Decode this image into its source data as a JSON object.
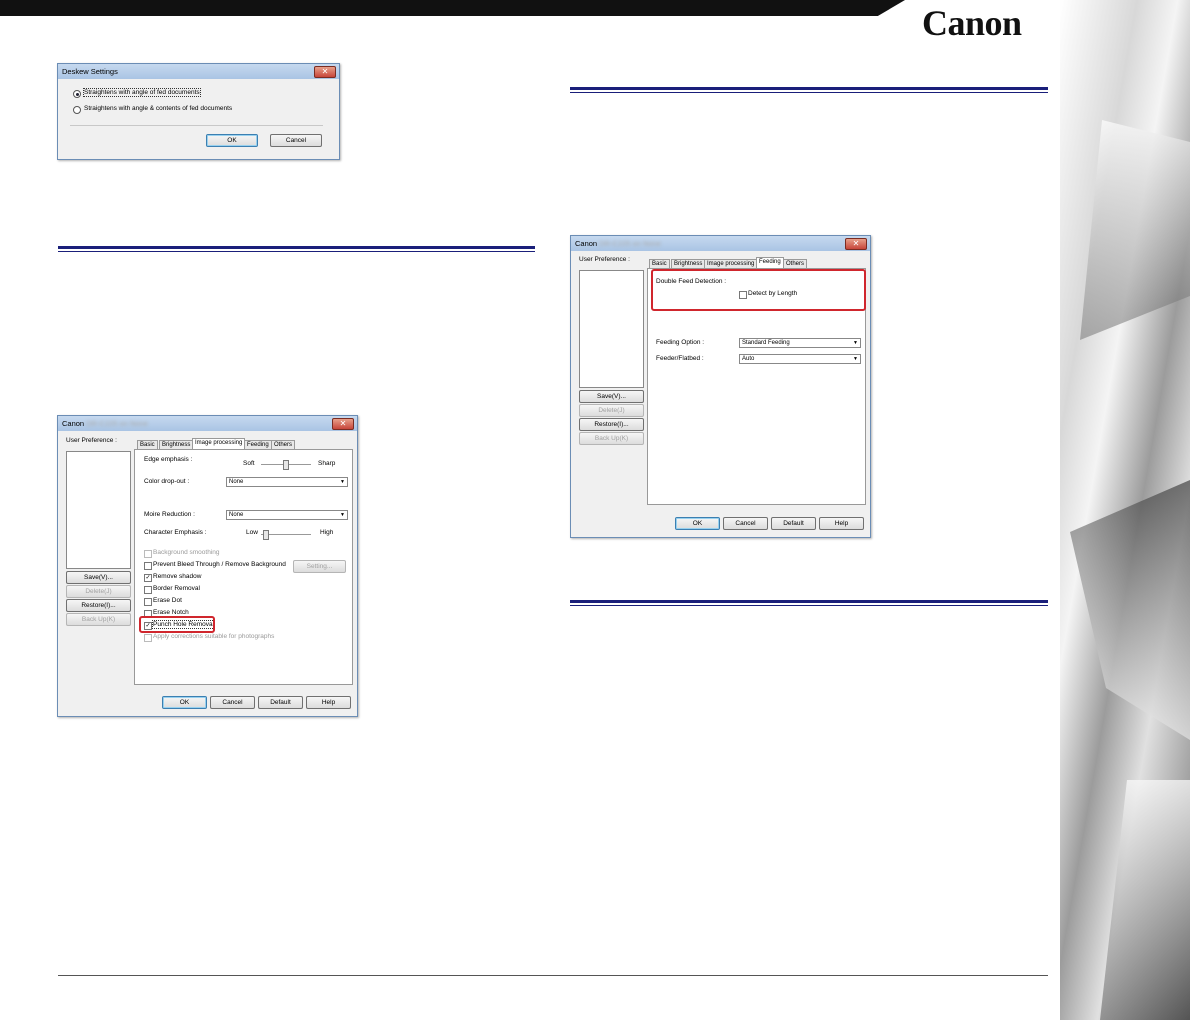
{
  "brand": {
    "logo": "Canon"
  },
  "deskew_dialog": {
    "title": "Deskew Settings",
    "options": [
      {
        "label": "Straightens with angle of fed documents",
        "selected": true
      },
      {
        "label": "Straightens with angle & contents of fed documents",
        "selected": false
      }
    ],
    "ok_label": "OK",
    "cancel_label": "Cancel"
  },
  "image_dialog": {
    "title": "Canon",
    "user_pref_label": "User Preference :",
    "buttons_left": {
      "save": "Save(V)...",
      "delete": "Delete(J)",
      "restore": "Restore(I)...",
      "backup": "Back Up(K)"
    },
    "tabs": [
      "Basic",
      "Brightness",
      "Image processing",
      "Feeding",
      "Others"
    ],
    "active_tab": "Image processing",
    "edge_emphasis": {
      "label": "Edge emphasis :",
      "min": "Soft",
      "max": "Sharp"
    },
    "color_dropout": {
      "label": "Color drop-out :",
      "value": "None"
    },
    "moire": {
      "label": "Moire Reduction :",
      "value": "None"
    },
    "char_emphasis": {
      "label": "Character Emphasis :",
      "min": "Low",
      "max": "High"
    },
    "checkboxes": [
      {
        "label": "Background smoothing",
        "checked": false,
        "enabled": false
      },
      {
        "label": "Prevent Bleed Through / Remove Background",
        "checked": false,
        "enabled": true
      },
      {
        "label": "Remove shadow",
        "checked": true,
        "enabled": true
      },
      {
        "label": "Border Removal",
        "checked": false,
        "enabled": true
      },
      {
        "label": "Erase Dot",
        "checked": false,
        "enabled": true
      },
      {
        "label": "Erase Notch",
        "checked": false,
        "enabled": true
      },
      {
        "label": "Punch Hole Removal",
        "checked": true,
        "enabled": true
      },
      {
        "label": "Apply corrections suitable for photographs",
        "checked": false,
        "enabled": false
      }
    ],
    "setting_label": "Setting...",
    "ok_label": "OK",
    "cancel_label": "Cancel",
    "default_label": "Default",
    "help_label": "Help"
  },
  "feeding_dialog": {
    "title": "Canon",
    "user_pref_label": "User Preference :",
    "buttons_left": {
      "save": "Save(V)...",
      "delete": "Delete(J)",
      "restore": "Restore(I)...",
      "backup": "Back Up(K)"
    },
    "tabs": [
      "Basic",
      "Brightness",
      "Image processing",
      "Feeding",
      "Others"
    ],
    "active_tab": "Feeding",
    "double_feed_label": "Double Feed Detection :",
    "detect_length_label": "Detect by Length",
    "feeding_option": {
      "label": "Feeding Option :",
      "value": "Standard Feeding"
    },
    "feeder_flatbed": {
      "label": "Feeder/Flatbed :",
      "value": "Auto"
    },
    "ok_label": "OK",
    "cancel_label": "Cancel",
    "default_label": "Default",
    "help_label": "Help"
  }
}
